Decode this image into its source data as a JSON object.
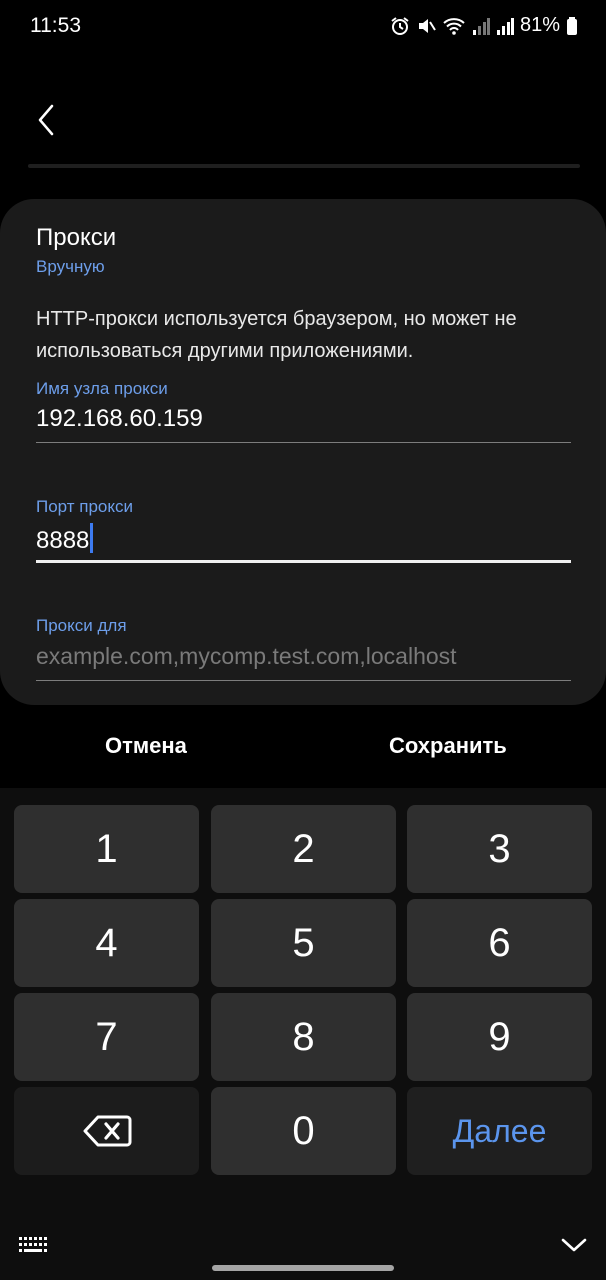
{
  "status_bar": {
    "time": "11:53",
    "battery": "81%",
    "icons": [
      "alarm-icon",
      "mute-icon",
      "wifi-icon",
      "signal-icon",
      "signal-icon",
      "battery-icon"
    ]
  },
  "dialog": {
    "title": "Прокси",
    "subtitle": "Вручную",
    "description": "HTTP-прокси используется браузером, но может не использоваться другими приложениями.",
    "host_label": "Имя узла прокси",
    "host_value": "192.168.60.159",
    "port_label": "Порт прокси",
    "port_value": "8888",
    "bypass_label": "Прокси для",
    "bypass_placeholder": "example.com,mycomp.test.com,localhost"
  },
  "actions": {
    "cancel": "Отмена",
    "save": "Сохранить"
  },
  "keyboard": {
    "keys": [
      "1",
      "2",
      "3",
      "4",
      "5",
      "6",
      "7",
      "8",
      "9",
      "0"
    ],
    "next_label": "Далее",
    "accent_color": "#5b95ed"
  }
}
